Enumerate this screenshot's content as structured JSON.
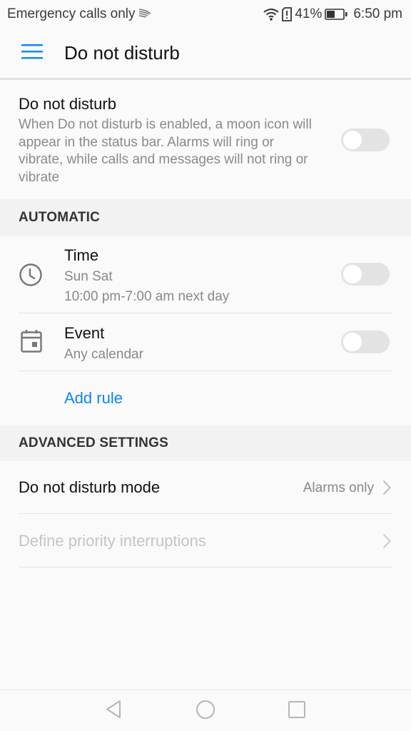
{
  "status_bar": {
    "carrier_text": "Emergency calls only",
    "battery_percent": "41%",
    "time": "6:50 pm",
    "icons": [
      "swiftkey-icon",
      "wifi-icon",
      "sim-alert-icon",
      "battery-icon"
    ]
  },
  "app_bar": {
    "title": "Do not disturb",
    "menu_icon": "hamburger-menu-icon"
  },
  "dnd": {
    "title": "Do not disturb",
    "description": "When Do not disturb is enabled, a moon icon will appear in the status bar. Alarms will ring or vibrate, while calls and messages will not ring or vibrate",
    "enabled": false
  },
  "automatic": {
    "header": "AUTOMATIC",
    "rules": [
      {
        "icon": "clock-icon",
        "title": "Time",
        "subtitle_1": "Sun Sat",
        "subtitle_2": "10:00 pm-7:00 am next day",
        "enabled": false
      },
      {
        "icon": "calendar-icon",
        "title": "Event",
        "subtitle_1": "Any calendar",
        "enabled": false
      }
    ],
    "add_rule_label": "Add rule"
  },
  "advanced": {
    "header": "ADVANCED SETTINGS",
    "items": [
      {
        "label": "Do not disturb mode",
        "value": "Alarms only",
        "enabled": true
      },
      {
        "label": "Define priority interruptions",
        "value": "",
        "enabled": false
      }
    ]
  },
  "nav_bar": {
    "buttons": [
      "back",
      "home",
      "recents"
    ]
  },
  "colors": {
    "accent": "#0a84ff",
    "toggle_off_track": "#e3e3e3",
    "disabled_text": "#c4c4c4"
  }
}
